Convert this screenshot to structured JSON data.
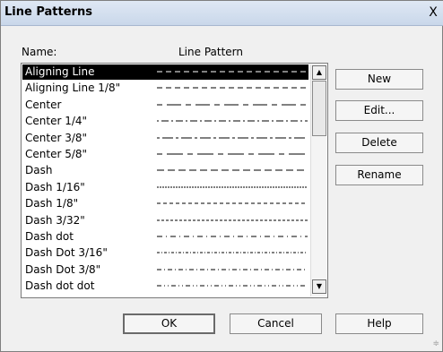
{
  "dialog": {
    "title": "Line Patterns",
    "close_label": "X"
  },
  "headers": {
    "name": "Name:",
    "pattern": "Line Pattern"
  },
  "patterns": [
    {
      "name": "Aligning Line",
      "dash": "6 4",
      "selected": true
    },
    {
      "name": "Aligning Line 1/8\"",
      "dash": "6 4",
      "selected": false
    },
    {
      "name": "Center",
      "dash": "6 5 16 5",
      "selected": false
    },
    {
      "name": "Center 1/4\"",
      "dash": "2 3 8 3",
      "selected": false
    },
    {
      "name": "Center 3/8\"",
      "dash": "3 3 12 3",
      "selected": false
    },
    {
      "name": "Center 5/8\"",
      "dash": "6 5 18 5",
      "selected": false
    },
    {
      "name": "Dash",
      "dash": "8 4",
      "selected": false
    },
    {
      "name": "Dash 1/16\"",
      "dash": "2 1",
      "selected": false
    },
    {
      "name": "Dash 1/8\"",
      "dash": "4 3",
      "selected": false
    },
    {
      "name": "Dash 3/32\"",
      "dash": "3 2",
      "selected": false
    },
    {
      "name": "Dash dot",
      "dash": "6 4 1 4",
      "selected": false
    },
    {
      "name": "Dash Dot 3/16\"",
      "dash": "3 2 1 2",
      "selected": false
    },
    {
      "name": "Dash Dot 3/8\"",
      "dash": "5 3 1 3",
      "selected": false
    },
    {
      "name": "Dash dot dot",
      "dash": "5 3 1 3 1 3",
      "selected": false
    }
  ],
  "buttons": {
    "new": "New",
    "edit": "Edit...",
    "delete": "Delete",
    "rename": "Rename",
    "ok": "OK",
    "cancel": "Cancel",
    "help": "Help"
  },
  "icons": {
    "scroll_up": "up-arrow",
    "scroll_down": "down-arrow",
    "resize_grip": "resize-grip"
  }
}
